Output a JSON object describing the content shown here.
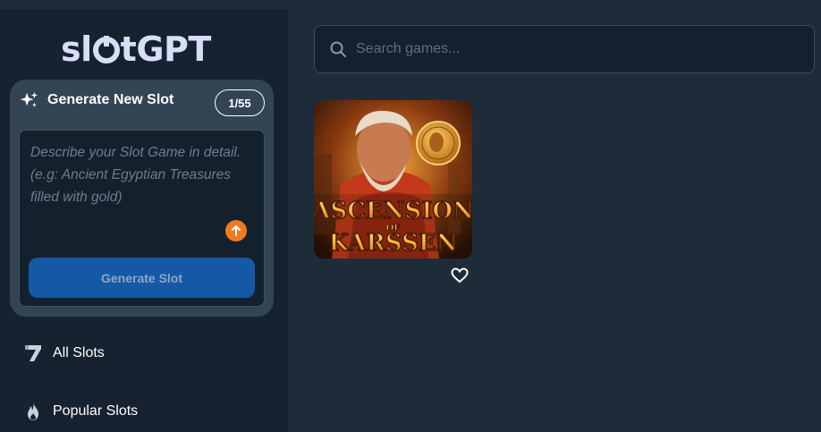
{
  "brand": {
    "logo_part1": "sl",
    "logo_part2": "tGPT"
  },
  "generator": {
    "title": "Generate New Slot",
    "counter": "1/55",
    "prompt_placeholder": "Describe your Slot Game in detail. (e.g: Ancient Egyptian Treasures filled with gold)",
    "button_label": "Generate Slot"
  },
  "nav": {
    "items": [
      {
        "label": "All Slots",
        "icon": "seven-icon"
      },
      {
        "label": "Popular Slots",
        "icon": "flame-icon"
      }
    ]
  },
  "search": {
    "placeholder": "Search games..."
  },
  "games": [
    {
      "title_line1": "ASCENSION",
      "title_line2": "OF",
      "title_line3": "KARSSEN",
      "favorite_icon": "heart-outline-icon"
    }
  ],
  "colors": {
    "accent_orange": "#f07a1e",
    "button_blue": "#1558a6",
    "background": "#1e2c3a",
    "sidebar": "#16222f"
  }
}
